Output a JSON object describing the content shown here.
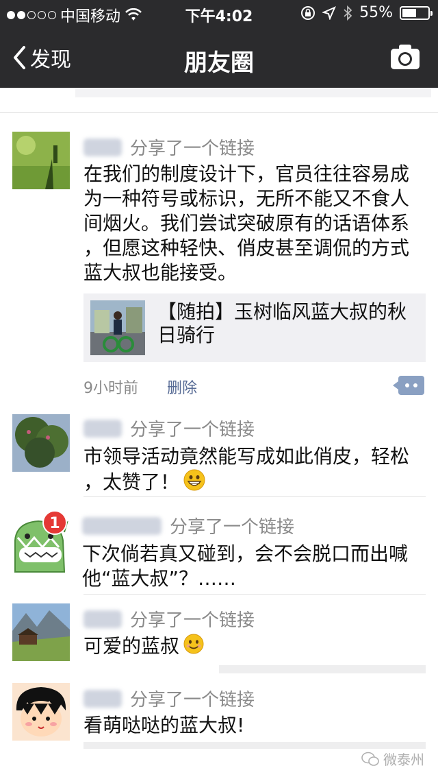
{
  "status_bar": {
    "carrier": "中国移动",
    "time": "下午4:02",
    "battery": "55%",
    "battery_level": 0.55,
    "icons": [
      "signal-dots-icon",
      "wifi-icon",
      "orientation-lock-icon",
      "location-icon",
      "bluetooth-icon",
      "battery-icon"
    ]
  },
  "nav": {
    "back_label": "发现",
    "title": "朋友圈",
    "right_icon": "camera-icon"
  },
  "colors": {
    "bar_bg": "#2b2b2d",
    "link_blue": "#576b95",
    "muted": "#8a8a8a"
  },
  "posts": [
    {
      "action": "分享了一个链接",
      "text": "在我们的制度设计下，官员往往容易成\n为一种符号或标识，无所不能又不食人\n间烟火。我们尝试突破原有的话语体系\n，但愿这种轻快、俏皮甚至调侃的方式\n蓝大叔也能接受。",
      "link_title": "【随拍】玉树临风蓝大叔的秋日骑行",
      "time": "9小时前",
      "delete_label": "删除"
    },
    {
      "action": "分享了一个链接",
      "text": "市领导活动竟然能写成如此俏皮，轻松\n，太赞了！",
      "emoji": "grinning-emoji-icon"
    },
    {
      "action": "分享了一个链接",
      "text": "下次倘若真又碰到，会不会脱口而出喊\n他“蓝大叔”？……",
      "badge": "1"
    },
    {
      "action": "分享了一个链接",
      "text": "可爱的蓝叔",
      "emoji": "smiling-emoji-icon"
    },
    {
      "action": "分享了一个链接",
      "text": "看萌哒哒的蓝大叔!"
    }
  ],
  "watermark": "微泰州"
}
